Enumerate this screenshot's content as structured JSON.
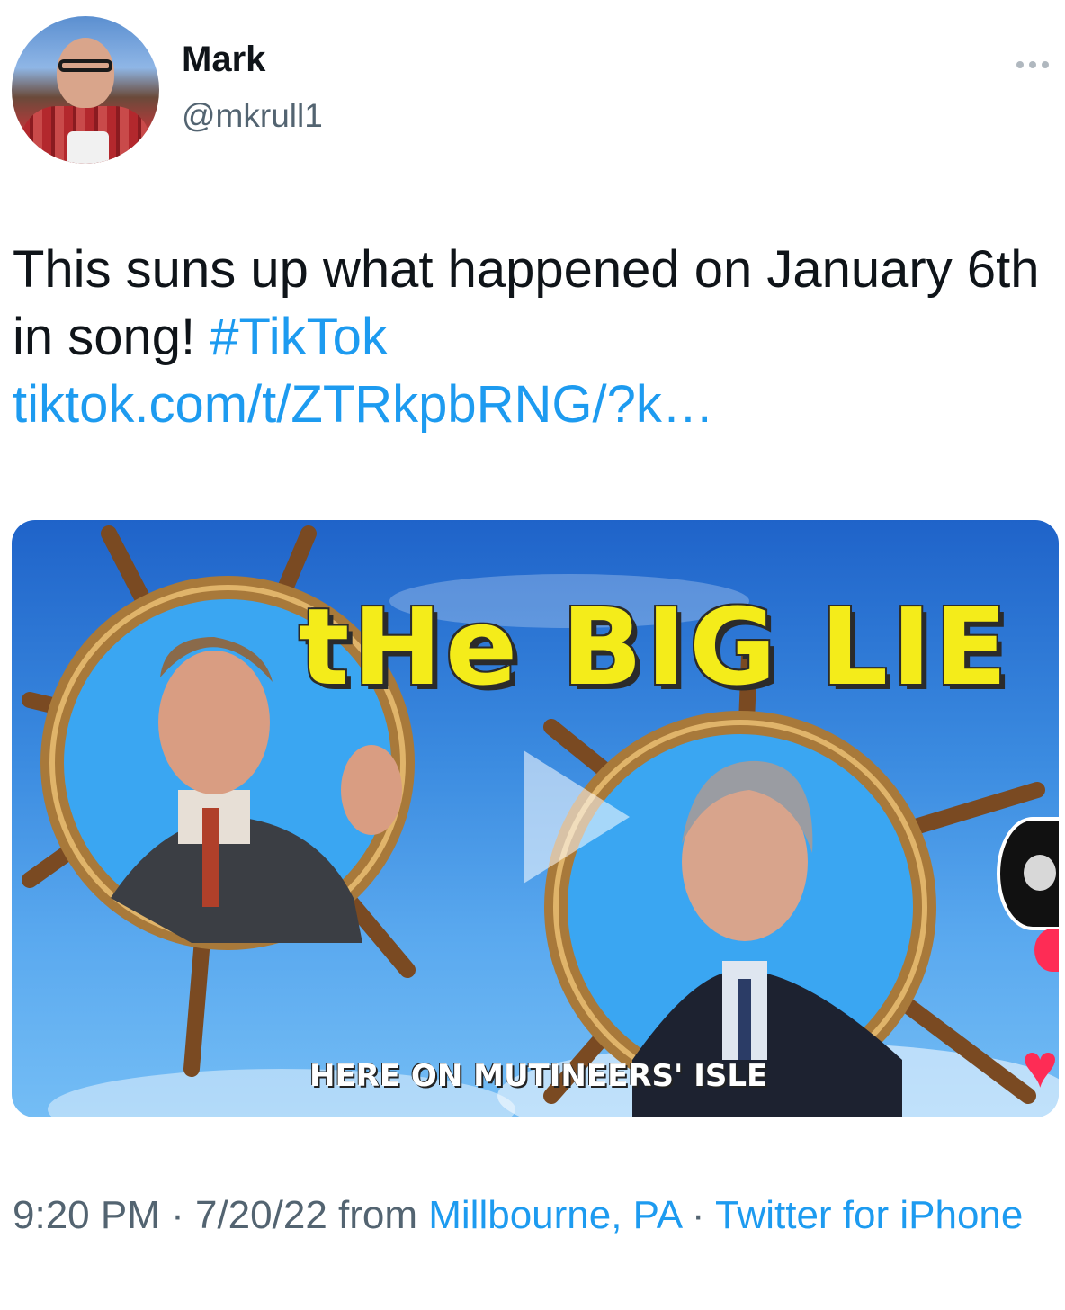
{
  "author": {
    "name": "Mark",
    "handle": "@mkrull1"
  },
  "tweet": {
    "text_main": "This suns up what happened on January 6th in song! ",
    "hashtag": "#TikTok",
    "link": "tiktok.com/t/ZTRkpbRNG/?k…"
  },
  "media": {
    "title": "tHe BIG LIE",
    "subtitle": "HERE ON MUTINEERS' ISLE"
  },
  "meta": {
    "time": "9:20 PM",
    "sep1": " · ",
    "date": "7/20/22",
    "from_label": " from ",
    "location": "Millbourne, PA",
    "sep2": " · ",
    "source": "Twitter for iPhone"
  },
  "colors": {
    "accent": "#1d9bf0",
    "secondary_text": "#536471",
    "title_yellow": "#f4ec1a"
  },
  "icons": {
    "more": "more-horizontal-icon",
    "play": "play-icon",
    "heart": "heart-icon"
  }
}
